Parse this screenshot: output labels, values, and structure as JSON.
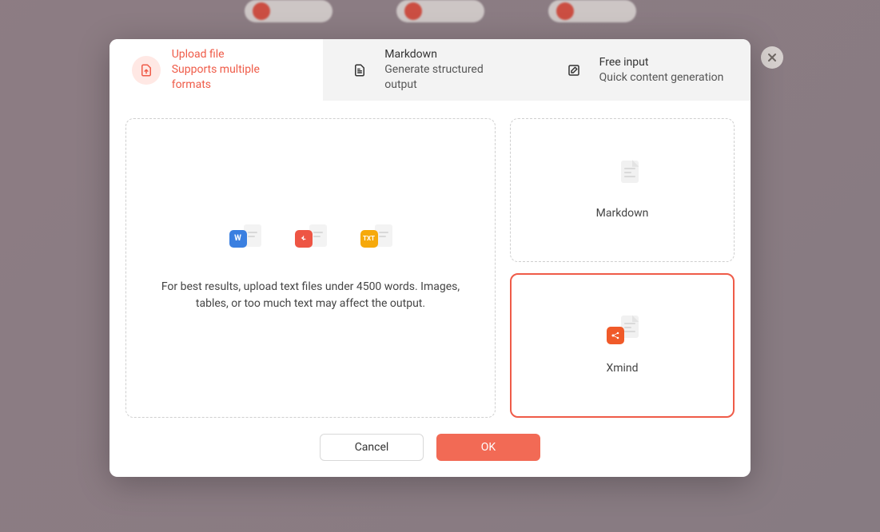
{
  "tabs": {
    "upload": {
      "title": "Upload file",
      "subtitle": "Supports multiple formats"
    },
    "markdown": {
      "title": "Markdown",
      "subtitle": "Generate structured output"
    },
    "freeinput": {
      "title": "Free input",
      "subtitle": "Quick content generation"
    }
  },
  "uploadZone": {
    "hint": "For best results, upload text files under 4500 words. Images, tables, or too much text may affect the output.",
    "icons": {
      "word": "W",
      "pdf": "",
      "txt": "TXT"
    }
  },
  "formatCards": {
    "markdown": {
      "label": "Markdown"
    },
    "xmind": {
      "label": "Xmind"
    }
  },
  "buttons": {
    "cancel": "Cancel",
    "ok": "OK"
  },
  "colors": {
    "accent": "#ef5b48",
    "dialogBg": "#ffffff"
  }
}
